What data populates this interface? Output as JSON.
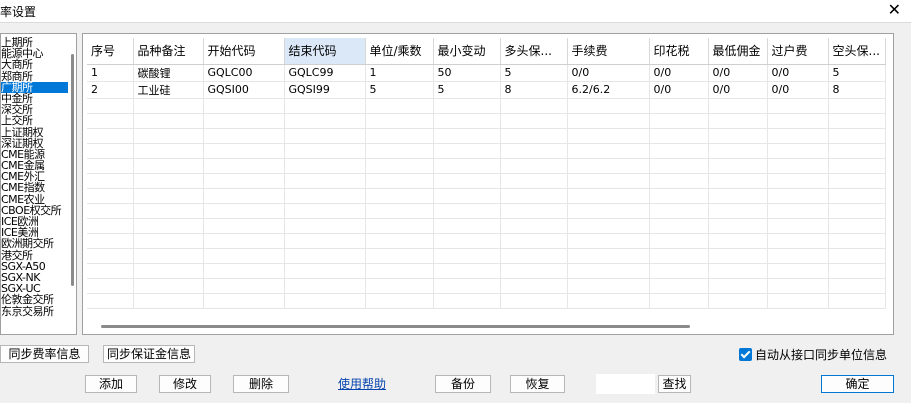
{
  "window": {
    "title": "率设置",
    "close_icon": "close-icon"
  },
  "exchanges": {
    "selected_index": 4,
    "items": [
      "上期所",
      "能源中心",
      "大商所",
      "郑商所",
      "广期所",
      "中金所",
      "深交所",
      "上交所",
      "上证期权",
      "深证期权",
      "CME能源",
      "CME金属",
      "CME外汇",
      "CME指数",
      "CME农业",
      "CBOE权交所",
      "ICE欧洲",
      "ICE美洲",
      "欧洲期交所",
      "港交所",
      "SGX-A50",
      "SGX-NK",
      "SGX-UC",
      "伦敦金交所",
      "东京交易所"
    ]
  },
  "grid": {
    "columns": [
      "序号",
      "品种备注",
      "开始代码",
      "结束代码",
      "单位/乘数",
      "最小变动",
      "多头保...",
      "手续费",
      "印花税",
      "最低佣金",
      "过户费",
      "空头保..."
    ],
    "highlighted_column": 3,
    "rows": [
      [
        "1",
        "碳酸锂",
        "GQLC00",
        "GQLC99",
        "1",
        "50",
        "5",
        "0/0",
        "0/0",
        "0/0",
        "0/0",
        "5"
      ],
      [
        "2",
        "工业硅",
        "GQSI00",
        "GQSI99",
        "5",
        "5",
        "8",
        "6.2/6.2",
        "0/0",
        "0/0",
        "0/0",
        "8"
      ]
    ],
    "empty_rows": 14
  },
  "buttons": {
    "sync_fee": "同步费率信息",
    "sync_margin": "同步保证金信息",
    "add": "添加",
    "modify": "修改",
    "delete": "删除",
    "help": "使用帮助",
    "backup": "备份",
    "restore": "恢复",
    "search": "查找",
    "ok": "确定"
  },
  "search": {
    "value": ""
  },
  "auto_sync": {
    "label": "自动从接口同步单位信息",
    "checked": true
  },
  "colors": {
    "accent": "#0078d7",
    "link": "#0645ad",
    "header_highlight": "#dbe8f8"
  }
}
